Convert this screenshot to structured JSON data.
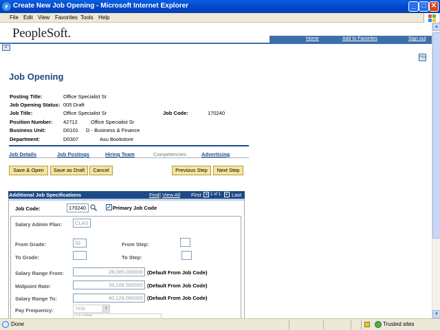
{
  "window": {
    "title": "Create New Job Opening - Microsoft Internet Explorer",
    "minimize": "_",
    "maximize": "□",
    "close": "✕"
  },
  "menu": [
    "File",
    "Edit",
    "View",
    "Favorites",
    "Tools",
    "Help"
  ],
  "header": {
    "logo": "PeopleSoft.",
    "links": {
      "home": "Home",
      "favorites": "Add to Favorites",
      "signout": "Sign out"
    }
  },
  "icons": {
    "expand": "▸",
    "help": "Help"
  },
  "page": {
    "title": "Job Opening",
    "fields": {
      "posting_title_label": "Posting Title:",
      "posting_title": "Office Specialist Sr",
      "status_label": "Job Opening Status:",
      "status": "005 Draft",
      "job_title_label": "Job Title:",
      "job_title": "Office Specialist Sr",
      "job_code_label": "Job Code:",
      "job_code": "170240",
      "position_label": "Position Number:",
      "position_number": "42712",
      "position_desc": "Office Specialist Sr",
      "bu_label": "Business Unit:",
      "bu_code": "D0101",
      "bu_desc": "D - Business & Finance",
      "dept_label": "Department:",
      "dept_code": "D0307",
      "dept_desc": "Asu Bookstore"
    },
    "tabs": [
      {
        "label": "Job Details"
      },
      {
        "label": "Job Postings"
      },
      {
        "label": "Hiring Team"
      },
      {
        "label": "Competencies"
      },
      {
        "label": "Advertising"
      }
    ],
    "buttons": {
      "save_open": "Save & Open",
      "save_draft": "Save as Draft",
      "cancel": "Cancel",
      "prev": "Previous Step",
      "next": "Next Step"
    }
  },
  "section": {
    "title": "Additional Job Specifications",
    "find": "Find",
    "view_all": "View All",
    "first": "First",
    "count": "1 of 1",
    "last": "Last",
    "job_code_label": "Job Code:",
    "job_code_value": "170240",
    "primary_label": "Primary Job Code",
    "salary_plan_label": "Salary Admin Plan:",
    "salary_plan_value": "CLAS",
    "from_grade_label": "From Grade:",
    "from_grade_value": "32",
    "from_step_label": "From Step:",
    "to_grade_label": "To Grade:",
    "to_step_label": "To Step:",
    "range_from_label": "Salary Range From:",
    "range_from_value": "28,085.000000",
    "midpoint_label": "Midpoint Rate:",
    "midpoint_value": "33,106.500000",
    "range_to_label": "Salary Range To:",
    "range_to_value": "40,128.000000",
    "default_note": "(Default From Job Code)",
    "pay_freq_label": "Pay Frequency:",
    "pay_freq_value": "Year",
    "extra_value": "US Dollar"
  },
  "status": {
    "left": "Done",
    "zone": "Trusted sites"
  }
}
